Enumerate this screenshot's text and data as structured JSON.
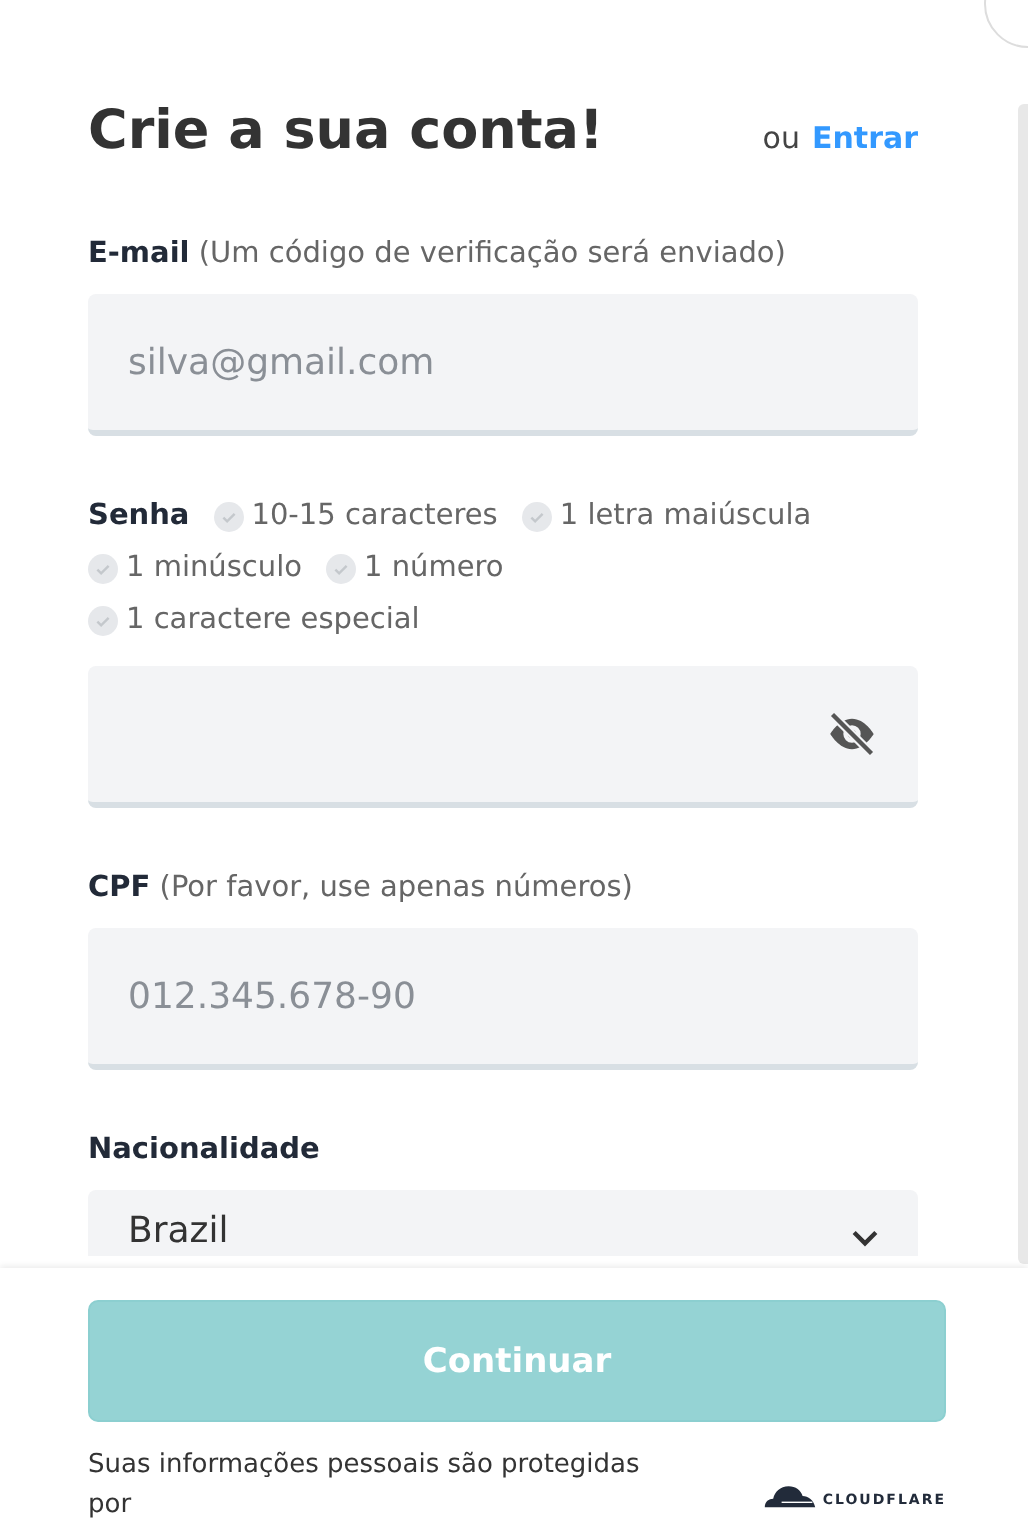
{
  "title": "Crie a sua conta!",
  "login_prompt": {
    "text": "ou",
    "link": "Entrar"
  },
  "email": {
    "label": "E-mail",
    "hint": "(Um código de verificação será enviado)",
    "placeholder": "silva@gmail.com"
  },
  "password": {
    "label": "Senha",
    "password_visible": false,
    "requirements": [
      {
        "text": "10-15 caracteres",
        "met": false
      },
      {
        "text": "1 letra maiúscula",
        "met": false
      },
      {
        "text": "1 minúsculo",
        "met": false
      },
      {
        "text": "1 número",
        "met": false
      },
      {
        "text": "1 caractere especial",
        "met": false
      }
    ]
  },
  "cpf": {
    "label": "CPF",
    "hint": "(Por favor, use apenas números)",
    "placeholder": "012.345.678-90"
  },
  "nationality": {
    "label": "Nacionalidade",
    "value": "Brazil"
  },
  "continue_button": {
    "label": "Continuar",
    "disabled": true
  },
  "footer": {
    "text": "Suas informações pessoais são protegidas por",
    "logo_text": "CLOUDFLARE"
  }
}
